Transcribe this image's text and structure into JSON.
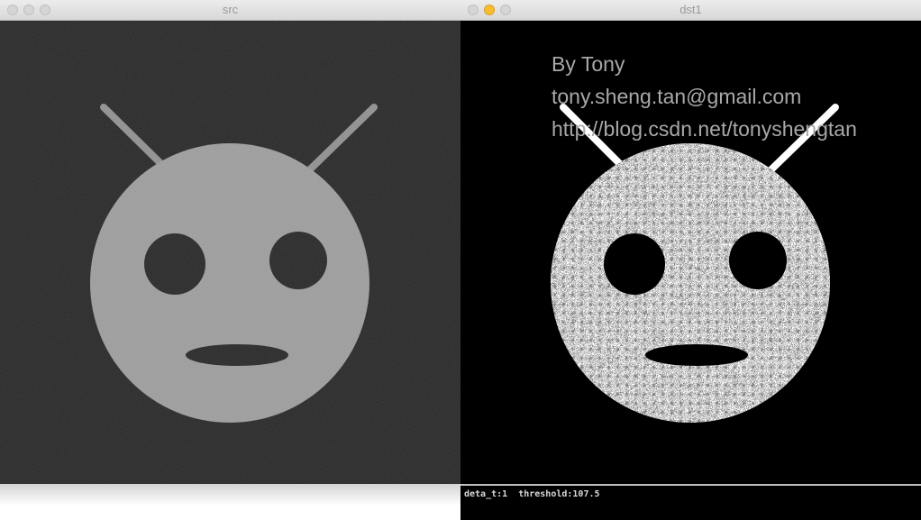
{
  "windows": {
    "src": {
      "title": "src"
    },
    "dst": {
      "title": "dst1"
    }
  },
  "overlay_text": {
    "line1": "By Tony",
    "line2": "tony.sheng.tan@gmail.com",
    "line3": "http://blog.csdn.net/tonyshengtan"
  },
  "status": {
    "text": "deta_t:1  threshold:107.5"
  },
  "colors": {
    "src_face": "#9c9c9c",
    "src_background": "#1c1c1c",
    "dst_face": "#ffffff",
    "dst_background": "#000000",
    "traffic_light_min": "#f5bd2f"
  }
}
